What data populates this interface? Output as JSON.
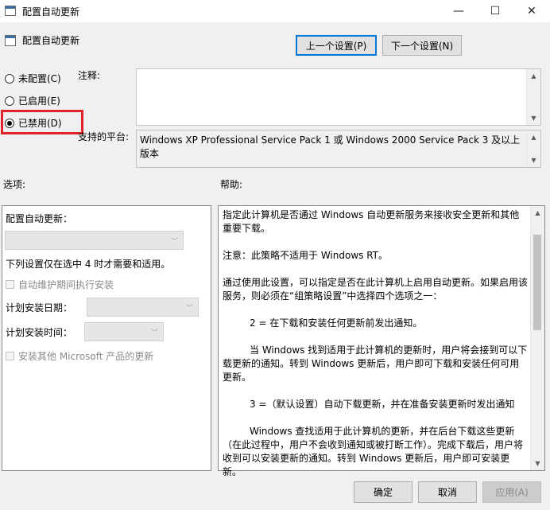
{
  "window": {
    "title": "配置自动更新",
    "controls": {
      "minimize": "—",
      "maximize": "☐",
      "close": "✕"
    }
  },
  "header": {
    "title": "配置自动更新",
    "prev_button": "上一个设置(P)",
    "next_button": "下一个设置(N)"
  },
  "state_options": [
    {
      "label": "未配置(C)",
      "checked": false
    },
    {
      "label": "已启用(E)",
      "checked": false
    },
    {
      "label": "已禁用(D)",
      "checked": true
    }
  ],
  "comment": {
    "label": "注释:",
    "value": ""
  },
  "supported": {
    "label": "支持的平台:",
    "value": "Windows XP Professional Service Pack 1 或 Windows 2000 Service Pack 3 及以上版本"
  },
  "options_section": {
    "label": "选项:",
    "configure_label": "配置自动更新：",
    "configure_value": "",
    "note": "下列设置仅在选中 4 时才需要和适用。",
    "maintenance_checkbox": "自动维护期间执行安装",
    "install_day_label": "计划安装日期：",
    "install_day_value": "",
    "install_time_label": "计划安装时间：",
    "install_time_value": "",
    "other_products_checkbox": "安装其他 Microsoft 产品的更新"
  },
  "help_section": {
    "label": "帮助:",
    "paragraphs": [
      "指定此计算机是否通过 Windows 自动更新服务来接收安全更新和其他重要下载。",
      "注意：此策略不适用于 Windows RT。",
      "通过使用此设置，可以指定是否在此计算机上启用自动更新。如果启用该服务，则必须在“组策略设置”中选择四个选项之一：",
      "2 = 在下载和安装任何更新前发出通知。",
      "当 Windows 找到适用于此计算机的更新时，用户将会接到可以下载更新的通知。转到 Windows 更新后，用户即可下载和安装任何可用更新。",
      "3 =（默认设置）自动下载更新，并在准备安装更新时发出通知",
      "Windows 查找适用于此计算机的更新，并在后台下载这些更新（在此过程中，用户不会收到通知或被打断工作）。完成下载后，用户将收到可以安装更新的通知。转到 Windows 更新后，用户即可安装更新。"
    ]
  },
  "footer": {
    "ok_button": "确定",
    "cancel_button": "取消",
    "apply_button": "应用(A)"
  },
  "colors": {
    "highlight_border": "#e0232b",
    "primary_button_border": "#0078d7"
  }
}
